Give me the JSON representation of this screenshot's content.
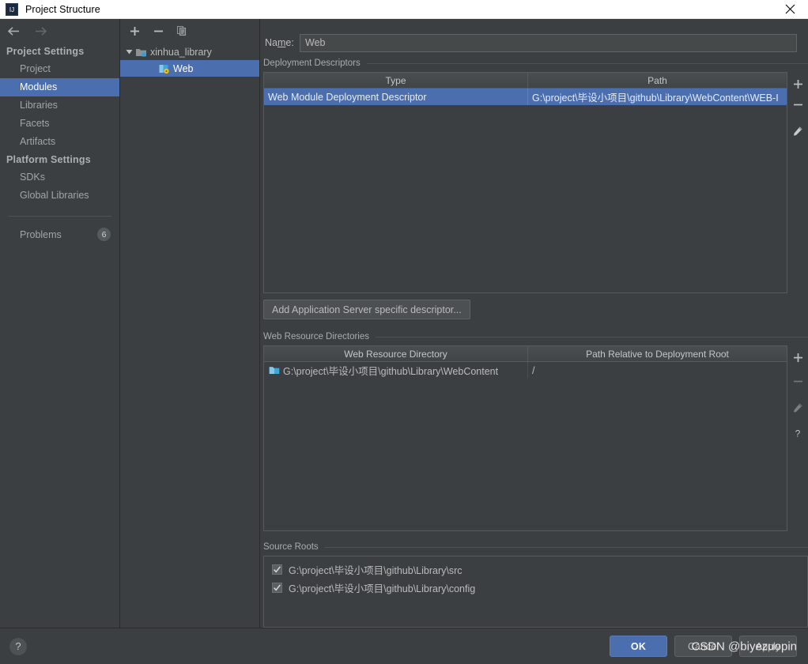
{
  "window": {
    "title": "Project Structure",
    "app_icon": "intellij-idea-icon",
    "close_icon": "close-icon"
  },
  "navigation": {
    "back_icon": "arrow-left-icon",
    "forward_icon": "arrow-right-icon"
  },
  "sidebar": {
    "groups": [
      {
        "label": "Project Settings",
        "items": [
          {
            "label": "Project",
            "selected": false
          },
          {
            "label": "Modules",
            "selected": true
          },
          {
            "label": "Libraries",
            "selected": false
          },
          {
            "label": "Facets",
            "selected": false
          },
          {
            "label": "Artifacts",
            "selected": false
          }
        ]
      },
      {
        "label": "Platform Settings",
        "items": [
          {
            "label": "SDKs",
            "selected": false
          },
          {
            "label": "Global Libraries",
            "selected": false
          }
        ]
      }
    ],
    "problems": {
      "label": "Problems",
      "count": "6"
    }
  },
  "module_tree": {
    "toolbar": [
      {
        "name": "add-module-button",
        "icon": "plus-icon"
      },
      {
        "name": "remove-module-button",
        "icon": "minus-icon"
      },
      {
        "name": "copy-module-button",
        "icon": "copy-icon"
      }
    ],
    "nodes": [
      {
        "label": "xinhua_library",
        "icon": "module-folder-icon",
        "expanded": true,
        "level": 0,
        "selected": false
      },
      {
        "label": "Web",
        "icon": "web-facet-icon",
        "level": 1,
        "selected": true
      }
    ]
  },
  "main": {
    "name_field": {
      "label_prefix": "Na",
      "label_accel": "m",
      "label_suffix": "e:",
      "value": "Web",
      "placeholder": ""
    },
    "deployment_descriptors": {
      "title": "Deployment Descriptors",
      "columns": [
        "Type",
        "Path"
      ],
      "rows": [
        {
          "type": "Web Module Deployment Descriptor",
          "path": "G:\\project\\毕设小项目\\github\\Library\\WebContent\\WEB-I",
          "selected": true
        }
      ],
      "toolbar": [
        {
          "name": "add-descriptor-button",
          "icon": "plus-icon",
          "enabled": true
        },
        {
          "name": "remove-descriptor-button",
          "icon": "minus-icon",
          "enabled": true
        },
        {
          "name": "edit-descriptor-button",
          "icon": "pencil-icon",
          "enabled": true
        }
      ],
      "add_button_label": "Add Application Server specific descriptor..."
    },
    "web_resource_directories": {
      "title": "Web Resource Directories",
      "columns": [
        "Web Resource Directory",
        "Path Relative to Deployment Root"
      ],
      "rows": [
        {
          "directory": "G:\\project\\毕设小项目\\github\\Library\\WebContent",
          "relative_path": "/",
          "icon": "folder-icon"
        }
      ],
      "toolbar": [
        {
          "name": "add-web-resource-button",
          "icon": "plus-icon",
          "enabled": true
        },
        {
          "name": "remove-web-resource-button",
          "icon": "minus-icon",
          "enabled": false
        },
        {
          "name": "edit-web-resource-button",
          "icon": "pencil-icon",
          "enabled": false
        },
        {
          "name": "help-web-resource-button",
          "icon": "question-icon",
          "enabled": true
        }
      ]
    },
    "source_roots": {
      "title": "Source Roots",
      "items": [
        {
          "label": "G:\\project\\毕设小项目\\github\\Library\\src",
          "checked": true
        },
        {
          "label": "G:\\project\\毕设小项目\\github\\Library\\config",
          "checked": true
        }
      ]
    }
  },
  "footer": {
    "help_icon": "question-icon",
    "buttons": [
      {
        "label": "OK",
        "primary": true
      },
      {
        "label": "Cancel",
        "primary": false
      },
      {
        "label": "Apply",
        "primary": false
      }
    ],
    "watermark": "CSDN @biyezuopin"
  },
  "colors": {
    "accent": "#4b6eaf",
    "background": "#3c3f41",
    "titlebar": "#ffffff",
    "border": "#555a5c",
    "text": "#bbbbbb",
    "folder_icon": "#389fd6"
  }
}
